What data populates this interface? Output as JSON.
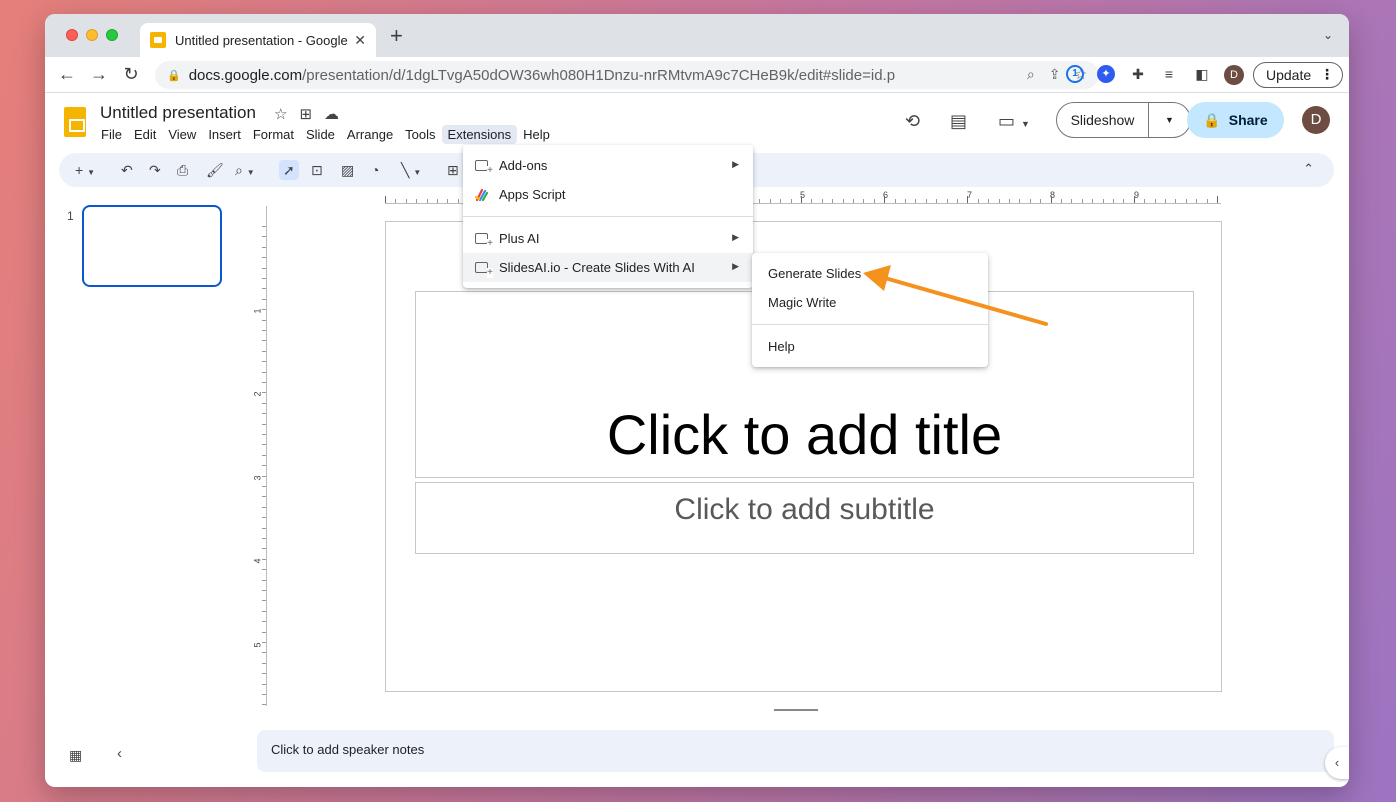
{
  "browser": {
    "tab_title": "Untitled presentation - Google",
    "url_host": "docs.google.com",
    "url_path": "/presentation/d/1dgLTvgA50dOW36wh080H1Dnzu-nrRMtvmA9c7CHeB9k/edit#slide=id.p",
    "update_label": "Update",
    "avatar_letter": "D"
  },
  "app": {
    "doc_title": "Untitled presentation",
    "menu": [
      "File",
      "Edit",
      "View",
      "Insert",
      "Format",
      "Slide",
      "Arrange",
      "Tools",
      "Extensions",
      "Help"
    ],
    "slideshow_label": "Slideshow",
    "share_label": "Share",
    "avatar_letter": "D",
    "toolbar_partial_text": "on"
  },
  "filmstrip": {
    "slide_number": "1"
  },
  "ruler": {
    "top_numbers": [
      "5",
      "6",
      "7",
      "8",
      "9"
    ],
    "left_numbers": [
      "1",
      "2",
      "3",
      "4",
      "5"
    ]
  },
  "slide": {
    "title_placeholder": "Click to add title",
    "subtitle_placeholder": "Click to add subtitle"
  },
  "notes": {
    "placeholder": "Click to add speaker notes"
  },
  "extensions_menu": {
    "items": [
      {
        "label": "Add-ons",
        "submenu": true
      },
      {
        "label": "Apps Script",
        "submenu": false
      },
      {
        "label": "Plus AI",
        "submenu": true
      },
      {
        "label": "SlidesAI.io - Create Slides With AI",
        "submenu": true
      }
    ]
  },
  "slidesai_submenu": {
    "items": [
      "Generate Slides",
      "Magic Write",
      "Help"
    ]
  },
  "colors": {
    "accent_blue": "#0b57d0",
    "share_bg": "#c2e7ff",
    "annotation_arrow": "#f5921e",
    "slides_yellow": "#f4b400"
  }
}
